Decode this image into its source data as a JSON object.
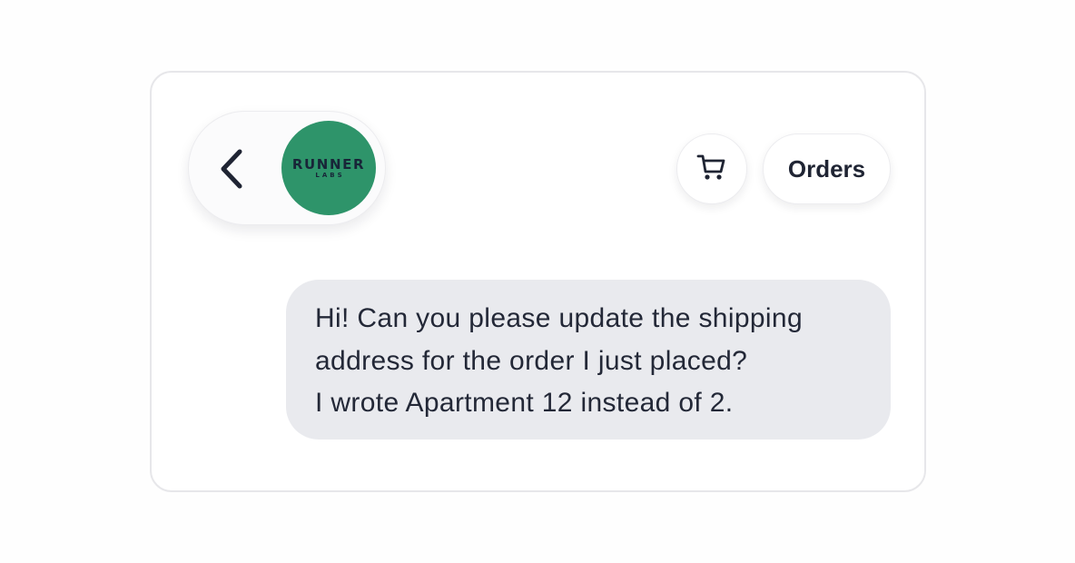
{
  "header": {
    "back_icon": "chevron-left-icon",
    "logo": {
      "main_text": "RUNNER",
      "sub_text": "LABS",
      "background_color": "#2e946a"
    },
    "cart_icon": "shopping-cart-icon",
    "orders_label": "Orders"
  },
  "message": {
    "lines": [
      "Hi! Can you please update the shipping",
      "address for the order I just placed?",
      "I wrote Apartment 12 instead of 2."
    ],
    "bubble_color": "#e9eaee"
  }
}
